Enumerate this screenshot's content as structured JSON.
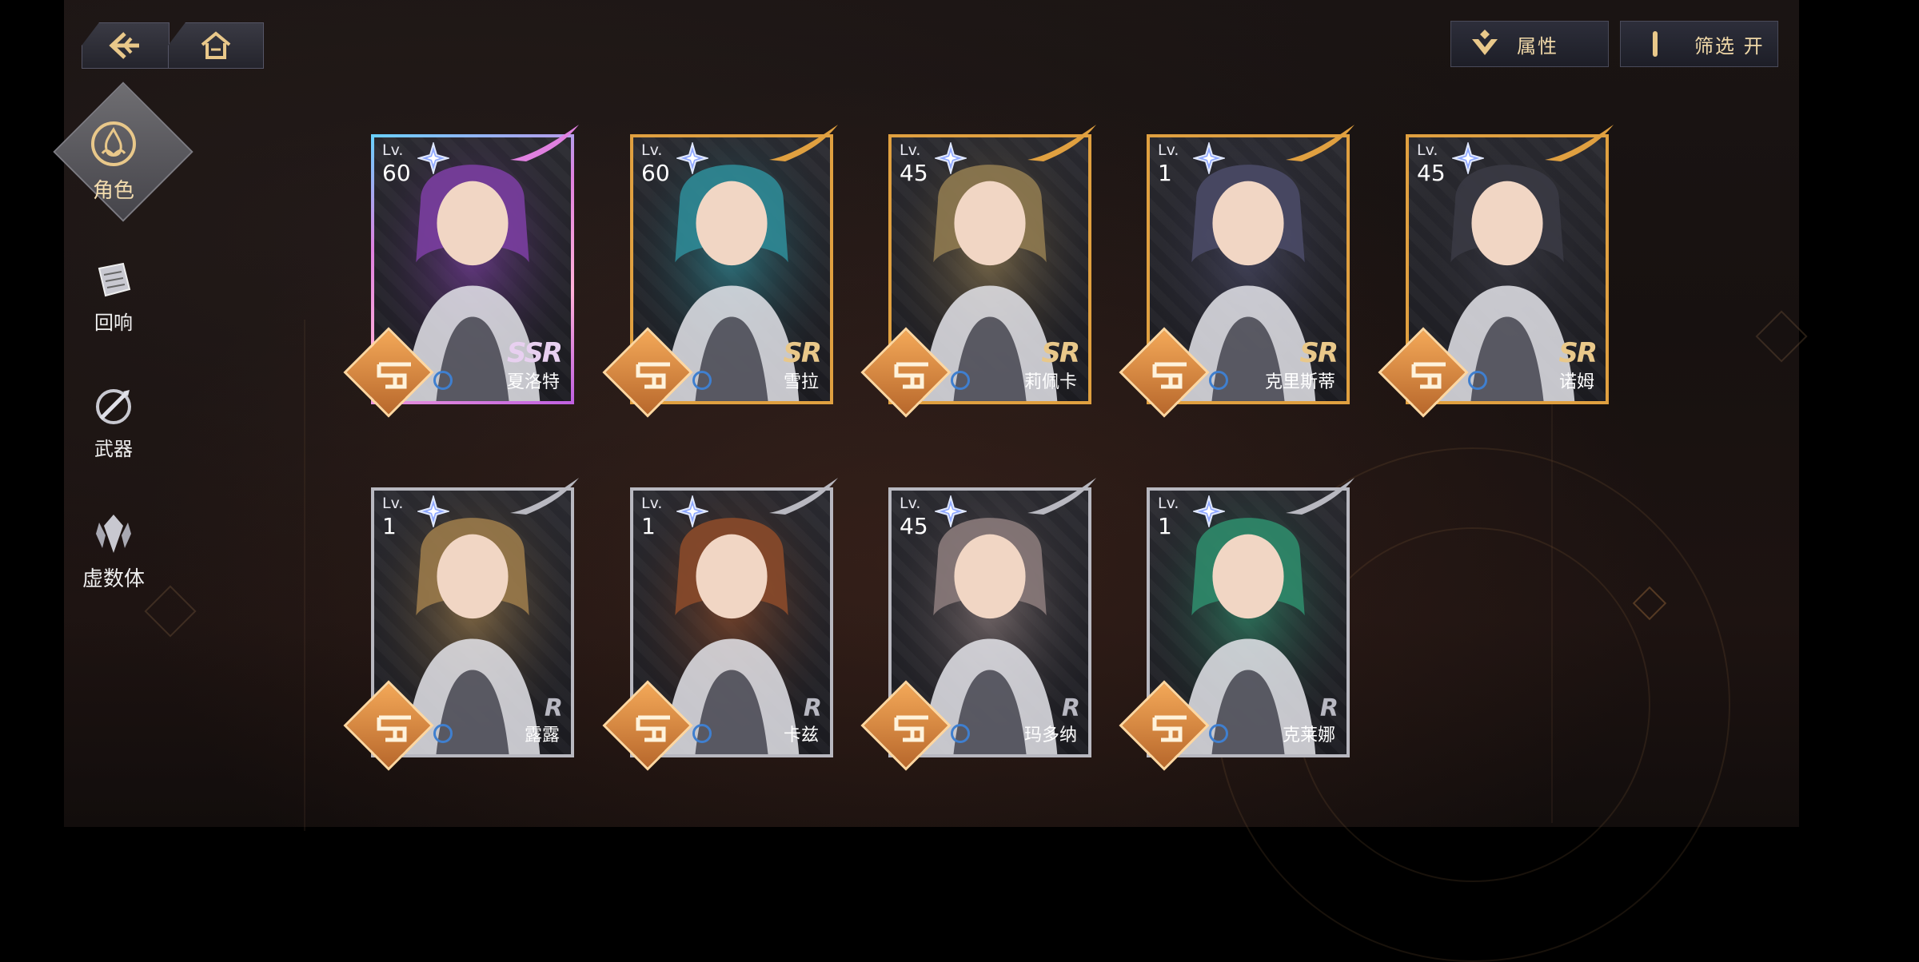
{
  "nav": {
    "back_icon": "back-arrow-icon",
    "home_icon": "home-icon"
  },
  "toolbar": {
    "attribute_label": "属性",
    "filter_label": "筛选 开"
  },
  "sidebar": {
    "items": [
      {
        "label": "角色",
        "icon": "flame-emblem-icon",
        "active": true
      },
      {
        "label": "回响",
        "icon": "echo-card-icon",
        "active": false
      },
      {
        "label": "武器",
        "icon": "weapon-icon",
        "active": false
      },
      {
        "label": "虚数体",
        "icon": "imaginary-crest-icon",
        "active": false
      }
    ]
  },
  "cards": [
    {
      "name": "夏洛特",
      "lv_label": "Lv.",
      "level": "60",
      "rank": "SSR",
      "portrait_hue": "#7a3ea0"
    },
    {
      "name": "雪拉",
      "lv_label": "Lv.",
      "level": "60",
      "rank": "SR",
      "portrait_hue": "#2f8a96"
    },
    {
      "name": "莉佩卡",
      "lv_label": "Lv.",
      "level": "45",
      "rank": "SR",
      "portrait_hue": "#8f7a50"
    },
    {
      "name": "克里斯蒂",
      "lv_label": "Lv.",
      "level": "1",
      "rank": "SR",
      "portrait_hue": "#4a4a66"
    },
    {
      "name": "诺姆",
      "lv_label": "Lv.",
      "level": "45",
      "rank": "SR",
      "portrait_hue": "#3a3a44"
    },
    {
      "name": "露露",
      "lv_label": "Lv.",
      "level": "1",
      "rank": "R",
      "portrait_hue": "#9a7a4a"
    },
    {
      "name": "卡兹",
      "lv_label": "Lv.",
      "level": "1",
      "rank": "R",
      "portrait_hue": "#8a4a2a"
    },
    {
      "name": "玛多纳",
      "lv_label": "Lv.",
      "level": "45",
      "rank": "R",
      "portrait_hue": "#8a7a7a"
    },
    {
      "name": "克莱娜",
      "lv_label": "Lv.",
      "level": "1",
      "rank": "R",
      "portrait_hue": "#2f8a6a"
    }
  ],
  "colors": {
    "accent_gold": "#e9c88a",
    "ssr_pink": "#e080e0",
    "sr_gold": "#e0a040",
    "r_silver": "#b8b8c0",
    "emblem_orange": "#e08a3c",
    "element_blue": "#3f7fcf"
  }
}
